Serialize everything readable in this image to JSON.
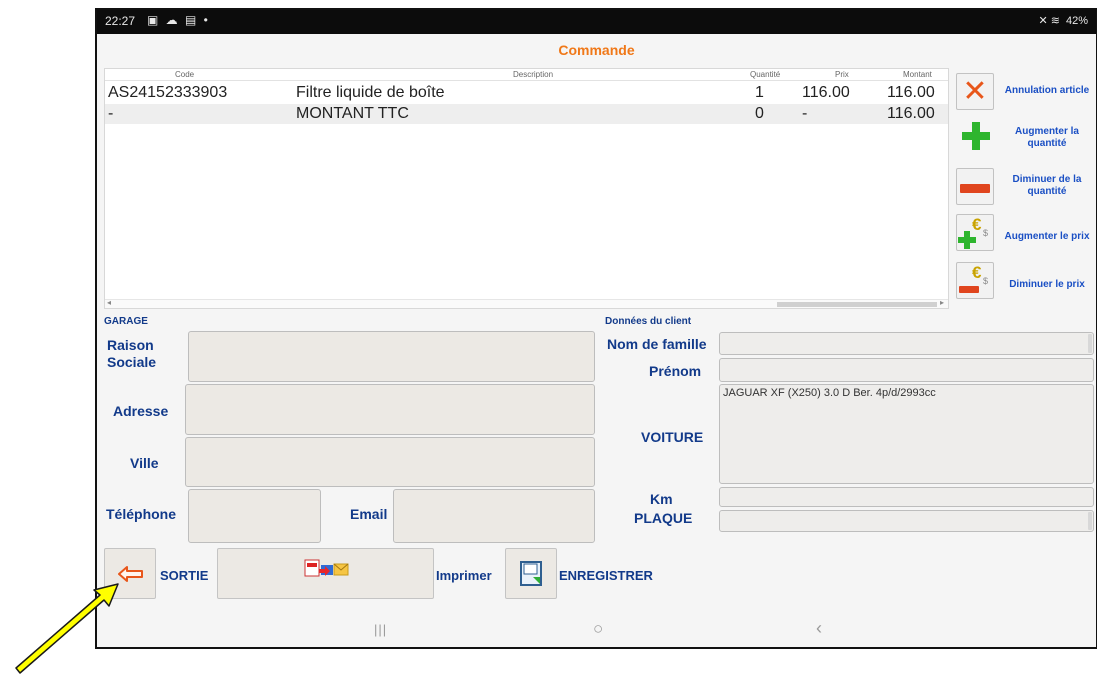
{
  "statusbar": {
    "time": "22:27",
    "notif_icons": "▣ ☁ ▤ •",
    "right_icons": "✕ ≋",
    "battery": "42%"
  },
  "app": {
    "title": "Commande"
  },
  "table": {
    "headers": {
      "code": "Code",
      "description": "Description",
      "quantity": "Quantité",
      "price": "Prix",
      "amount": "Montant"
    },
    "rows": [
      {
        "code": "AS24152333903",
        "description": "Filtre liquide de boîte",
        "quantity": "1",
        "price": "116.00",
        "amount": "116.00"
      },
      {
        "code": "-",
        "description": "MONTANT TTC",
        "quantity": "0",
        "price": "-",
        "amount": "116.00"
      }
    ]
  },
  "actions": {
    "cancel_item": "Annulation article",
    "increase_qty": "Augmenter la quantité",
    "decrease_qty": "Diminuer de la quantité",
    "increase_price": "Augmenter le prix",
    "decrease_price": "Diminuer le prix"
  },
  "garage": {
    "section": "GARAGE",
    "raison": "Raison Sociale",
    "adresse": "Adresse",
    "ville": "Ville",
    "telephone": "Téléphone",
    "email": "Email"
  },
  "client": {
    "section": "Données du client",
    "nom": "Nom de famille",
    "prenom": "Prénom",
    "voiture": "VOITURE",
    "voiture_value": "JAGUAR XF (X250) 3.0 D Ber. 4p/d/2993cc",
    "km": "Km",
    "plaque": "PLAQUE"
  },
  "bottom": {
    "exit_label": "SORTIE",
    "print_label": "Imprimer",
    "save_label": "ENREGISTRER"
  },
  "colors": {
    "title": "#f07818",
    "label_blue": "#123a8a",
    "action_blue": "#1a4fc4",
    "plus_green": "#2eb52e",
    "minus_red": "#e0451e",
    "arrow_yellow": "#ffff00"
  },
  "icons": {
    "cancel": "x-icon",
    "plus": "plus-icon",
    "minus": "minus-icon",
    "euro_plus": "euro-plus-icon",
    "euro_minus": "euro-minus-icon",
    "exit": "back-arrow-icon",
    "print": "pdf-print-icon",
    "save": "save-disk-icon",
    "annotation": "yellow-pointer-arrow"
  }
}
